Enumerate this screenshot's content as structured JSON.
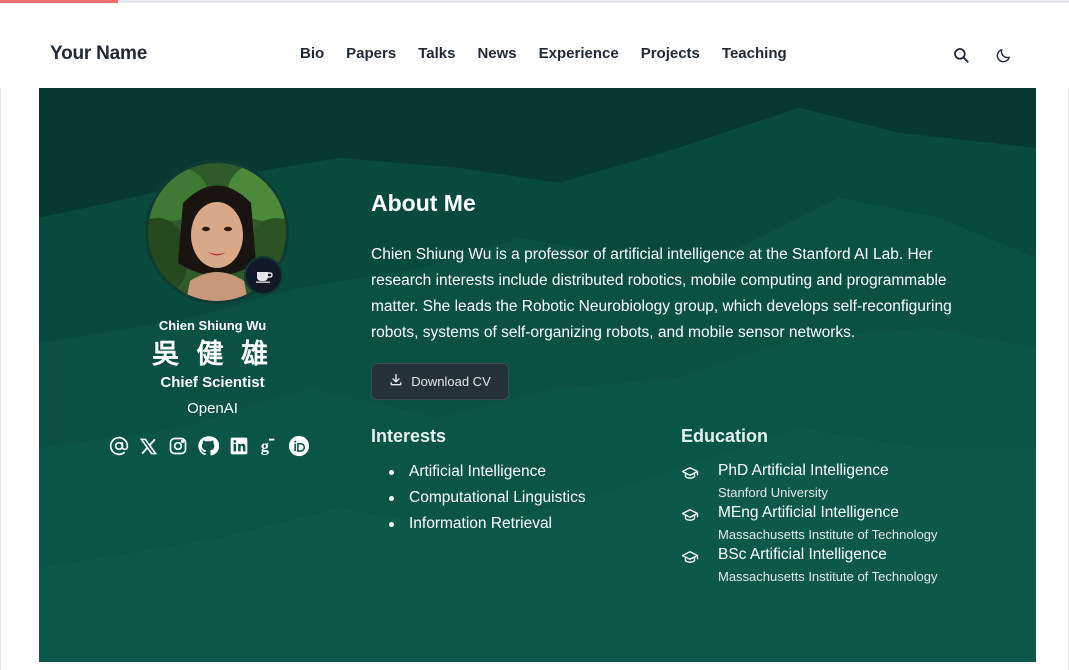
{
  "progress": {
    "percent": 11,
    "color": "#f87171"
  },
  "navbar": {
    "brand": "Your Name",
    "links": [
      "Bio",
      "Papers",
      "Talks",
      "News",
      "Experience",
      "Projects",
      "Teaching"
    ],
    "icons": [
      "search-icon",
      "moon-icon"
    ]
  },
  "colors": {
    "hero_bg": "#0b5547",
    "accent_dark": "#063d33",
    "button_bg": "#23313a"
  },
  "profile": {
    "name": "Chien Shiung Wu",
    "name_cjk": "吳 健 雄",
    "role": "Chief Scientist",
    "organization": "OpenAI",
    "badge_icon": "coffee-cup-icon",
    "socials": [
      "at-sign-icon",
      "x-twitter-icon",
      "instagram-icon",
      "github-icon",
      "linkedin-icon",
      "google-scholar-icon",
      "orcid-icon"
    ]
  },
  "about": {
    "title": "About Me",
    "bio": "Chien Shiung Wu is a professor of artificial intelligence at the Stanford AI Lab. Her research interests include distributed robotics, mobile computing and programmable matter. She leads the Robotic Neurobiology group, which develops self-reconfiguring robots, systems of self-organizing robots, and mobile sensor networks.",
    "cv_label": "Download CV",
    "cv_icon": "download-icon"
  },
  "interests": {
    "title": "Interests",
    "items": [
      "Artificial Intelligence",
      "Computational Linguistics",
      "Information Retrieval"
    ]
  },
  "education": {
    "title": "Education",
    "icon": "graduation-cap-icon",
    "items": [
      {
        "degree": "PhD Artificial Intelligence",
        "school": "Stanford University"
      },
      {
        "degree": "MEng Artificial Intelligence",
        "school": "Massachusetts Institute of Technology"
      },
      {
        "degree": "BSc Artificial Intelligence",
        "school": "Massachusetts Institute of Technology"
      }
    ]
  }
}
